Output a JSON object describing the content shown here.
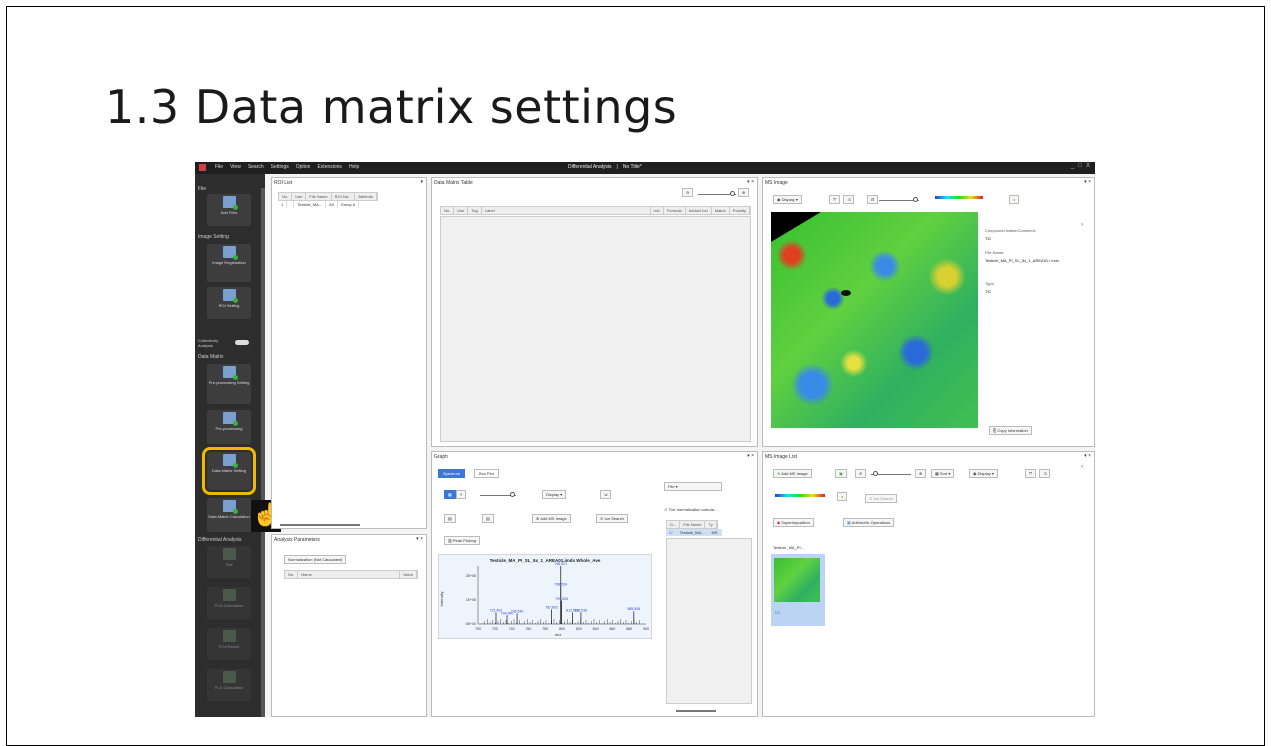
{
  "slide": {
    "title": "1.3 Data matrix settings"
  },
  "app": {
    "menu": [
      "File",
      "View",
      "Search",
      "Settings",
      "Option",
      "Extensions",
      "Help"
    ],
    "window_title": "Differential Analysis",
    "project": "No Title*",
    "window_controls": [
      "_",
      "□",
      "X"
    ]
  },
  "sidebar": {
    "sections": {
      "file": "File",
      "image_setting": "Image Setting",
      "data_matrix": "Data Matrix",
      "differential_analysis": "Differential Analysis"
    },
    "collectively": "Collectively Analysis",
    "buttons": {
      "add_files": "Add Files",
      "image_registration": "Image Registration",
      "roi_setting": "ROI Setting",
      "preprocessing_setting": "Pre-processing Setting",
      "preprocessing": "Pre-processing",
      "data_matrix_setting": "Data Matrix Setting",
      "data_matrix_calculation": "Data Matrix Calculation",
      "ttest": "Test",
      "pca_calculation": "PCA Calculation",
      "pca_result": "PCA Result",
      "pls_calculation": "PLS Calculation"
    }
  },
  "roi_list": {
    "title": "ROI List",
    "columns": [
      "No.",
      "Use",
      "File Name",
      "ROI Na...",
      "Attribute"
    ],
    "rows": [
      [
        "1",
        "",
        "Testicle_MA...",
        "All",
        "Group A"
      ]
    ]
  },
  "data_matrix_table": {
    "title": "Data Matrix Table",
    "columns": [
      "No.",
      "Use",
      "Tag",
      "Label",
      "m/z",
      "Formula",
      "Adduct Ion",
      "Matrix",
      "Polarity"
    ]
  },
  "analysis_parameters": {
    "title": "Analysis Parameters",
    "button": "Normalization (Not Calculated)",
    "columns": [
      "No.",
      "Name",
      "Value"
    ]
  },
  "graph": {
    "title": "Graph",
    "tabs": [
      "Spectrum",
      "Box Plot"
    ],
    "display_label": "Display",
    "add_ms_image": "Add MS Image",
    "ion_search": "Ion Search",
    "peak_picking": "Peak Picking",
    "file_select": "File",
    "warning": "The normalization calcula...",
    "file_columns": [
      "D...",
      "File Name",
      "Ty"
    ],
    "file_row": [
      "",
      "Testicle_MA...",
      "MS"
    ]
  },
  "chart_data": {
    "type": "line",
    "title": "Testicle_MA_PI_SL_5x_1_AREA01.imdx Whole_Ave",
    "xlabel": "m/z",
    "ylabel": "Intensity",
    "xlim": [
      700,
      900
    ],
    "xticks": [
      "700",
      "720",
      "740",
      "760",
      "780",
      "800",
      "820",
      "840",
      "860",
      "880",
      "900"
    ],
    "yticks": [
      "2E+06",
      "1E+06",
      "0E+00"
    ],
    "peaks": [
      {
        "x": 721.402,
        "y": 0.2,
        "label": "721.402"
      },
      {
        "x": 734.54,
        "y": 0.15,
        "label": "734.540"
      },
      {
        "x": 746.54,
        "y": 0.18,
        "label": "746.540"
      },
      {
        "x": 787.602,
        "y": 0.25,
        "label": "787.602"
      },
      {
        "x": 798.521,
        "y": 1.0,
        "label": "798.521"
      },
      {
        "x": 798.524,
        "y": 0.65,
        "label": "798.524"
      },
      {
        "x": 799.526,
        "y": 0.4,
        "label": "799.526"
      },
      {
        "x": 812.514,
        "y": 0.2,
        "label": "812.514"
      },
      {
        "x": 822.539,
        "y": 0.2,
        "label": "822.539"
      },
      {
        "x": 885.508,
        "y": 0.22,
        "label": "885.508"
      }
    ]
  },
  "ms_image": {
    "title": "MS Image",
    "display_label": "Display",
    "compound_label": "Compound Name/Comment:",
    "compound_value": "TIC",
    "file_label": "File Name:",
    "file_value": "Testicle_MA_PI_SL_5x_1_AREA01.i mdx",
    "type_label": "Type:",
    "type_value": "TIC",
    "copy_button": "Copy Information"
  },
  "ms_image_list": {
    "title": "MS Image List",
    "add_button": "Add MS Image",
    "sort_label": "Sort",
    "display_label": "Display",
    "ion_search": "Ion Search",
    "superimposition": "Superimposition",
    "arithmetic": "Arithmetic Operations",
    "thumb_label": "Testicle_MA_PI...",
    "thumb_type": "TIC"
  },
  "colors": {
    "highlight": "#f0b800",
    "accent": "#3b78d0",
    "sidebar": "#2d2d2d",
    "titlebar": "#1f1f1f"
  }
}
